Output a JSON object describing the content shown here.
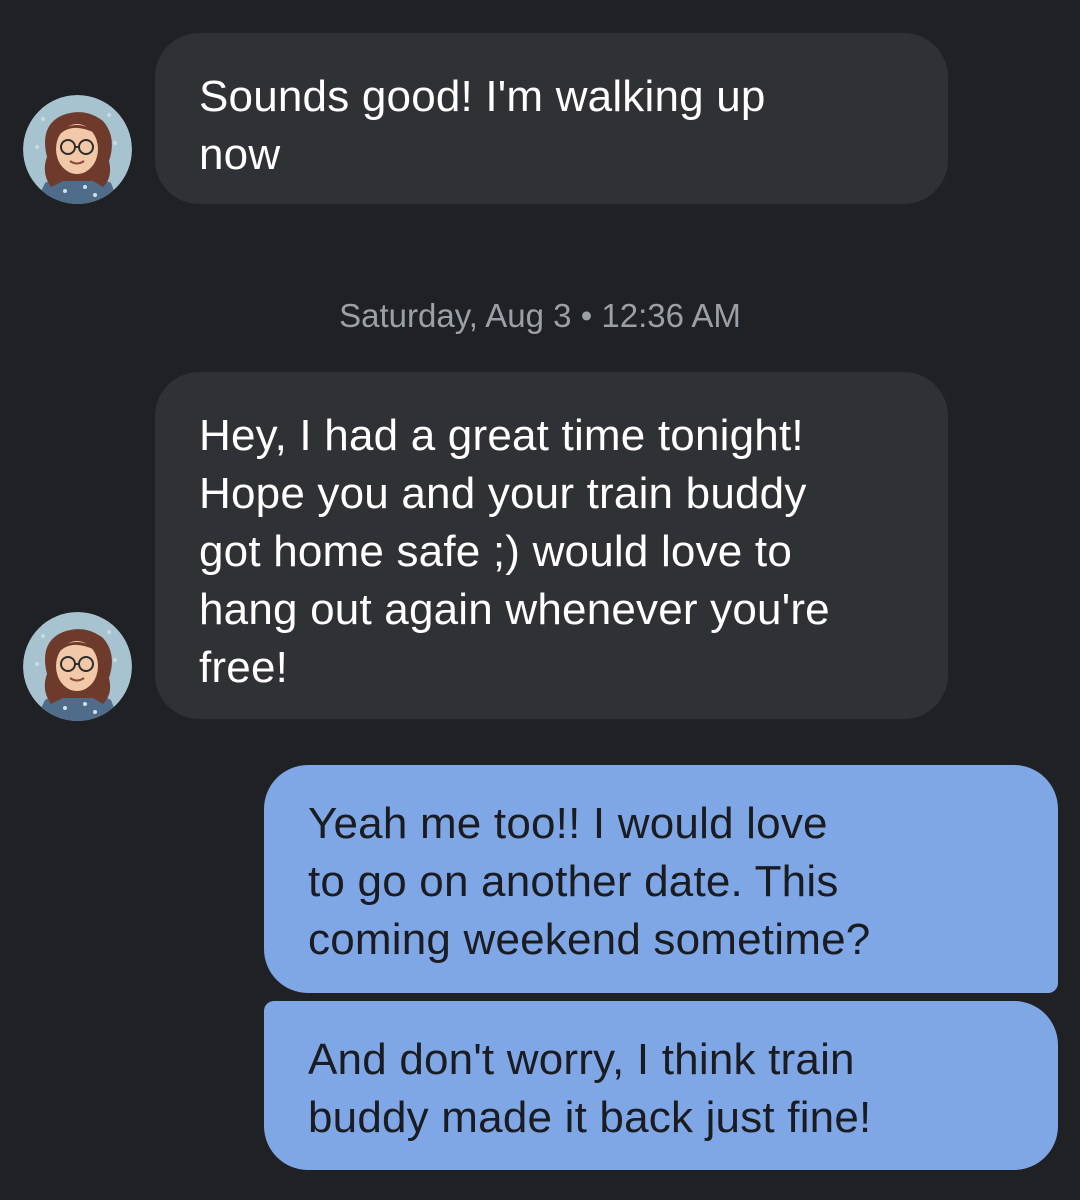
{
  "conversation": {
    "messages": [
      {
        "direction": "incoming",
        "lines": [
          "Sounds good! I'm walking up",
          "now"
        ]
      },
      {
        "direction": "incoming",
        "lines": [
          "Hey, I had a great time tonight!",
          "Hope you and your train buddy",
          "got home safe ;) would love to",
          "hang out again whenever you're",
          "free!"
        ]
      },
      {
        "direction": "outgoing",
        "lines": [
          "Yeah me too!! I would love",
          "to go on another date. This",
          "coming weekend sometime?"
        ]
      },
      {
        "direction": "outgoing",
        "lines": [
          "And don't worry, I think train",
          "buddy made it back just fine!"
        ]
      }
    ],
    "timestamp": {
      "day": "Saturday, Aug 3",
      "separator": "•",
      "time": "12:36 AM"
    },
    "contact_avatar_icon": "avatar-illustration-icon"
  },
  "colors": {
    "background": "#202124",
    "incoming_bubble": "#303134",
    "outgoing_bubble": "#7fa7e5",
    "timestamp_text": "#9aa0a6"
  }
}
